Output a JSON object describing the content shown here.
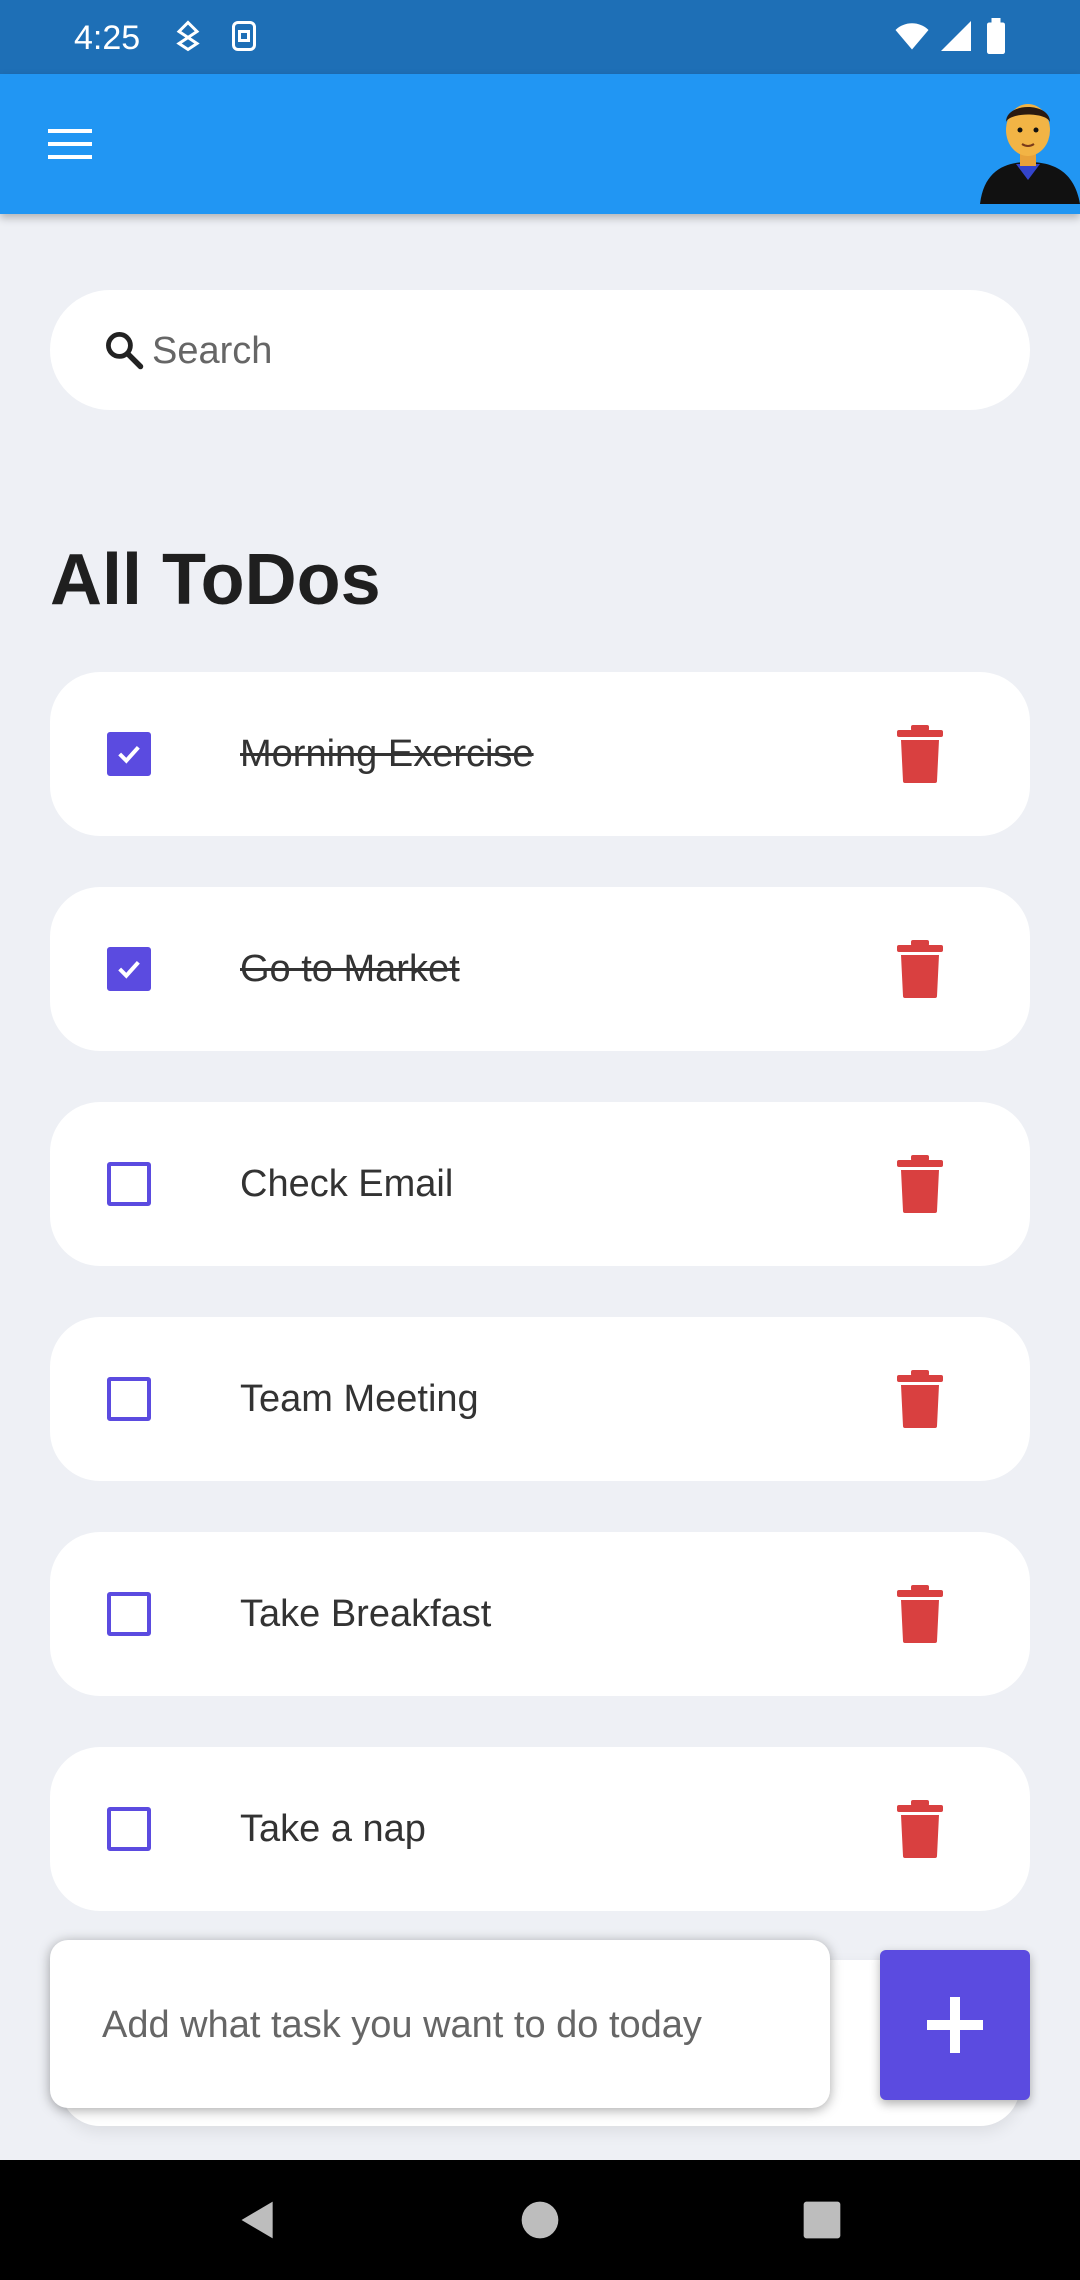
{
  "status_bar": {
    "time": "4:25",
    "left_icons": [
      "navigation-icon",
      "sim-icon"
    ],
    "right_icons": [
      "wifi-icon",
      "signal-icon",
      "battery-icon"
    ]
  },
  "app_bar": {
    "menu_icon": "menu-icon",
    "avatar": "avatar",
    "color": "#2196f3"
  },
  "search": {
    "placeholder": "Search",
    "value": ""
  },
  "page": {
    "title": "All ToDos"
  },
  "todos": [
    {
      "text": "Morning Exercise",
      "done": true
    },
    {
      "text": "Go to Market",
      "done": true
    },
    {
      "text": "Check Email",
      "done": false
    },
    {
      "text": "Team Meeting",
      "done": false
    },
    {
      "text": "Take Breakfast",
      "done": false
    },
    {
      "text": "Take a nap",
      "done": false
    }
  ],
  "add_task": {
    "placeholder": "Add what task you want to do today",
    "value": "",
    "button_icon": "plus-icon"
  },
  "colors": {
    "accent": "#5b4be0",
    "delete": "#d94040",
    "status_bar": "#1e6fb6"
  },
  "nav_bar": {
    "buttons": [
      "back-icon",
      "home-icon",
      "recents-icon"
    ]
  }
}
